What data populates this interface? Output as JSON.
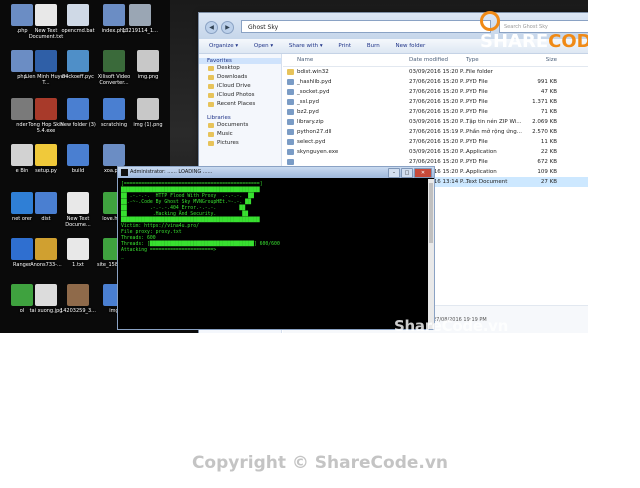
{
  "desktop_icons": [
    {
      "label": ".php",
      "color": "#6b8dc4"
    },
    {
      "label": "New Text Document.txt",
      "color": "#e8e8e8"
    },
    {
      "label": "opencmd.bat",
      "color": "#cfd9e6"
    },
    {
      "label": "index.php",
      "color": "#6b8dc4"
    },
    {
      "label": "13219114_1...",
      "color": "#9aa6b4"
    },
    {
      "label": "php",
      "color": "#6b8dc4"
    },
    {
      "label": "Lien Minh Huyen T...",
      "color": "#2f5fa7"
    },
    {
      "label": "84ckoeff.pyc",
      "color": "#4f8fc8"
    },
    {
      "label": "Xilisoft Video Converter...",
      "color": "#3a6a3a"
    },
    {
      "label": "img.png",
      "color": "#c8c8c8"
    },
    {
      "label": "nder",
      "color": "#7a7a7a"
    },
    {
      "label": "Tong Hop Skin 5.4.exe",
      "color": "#a83a2a"
    },
    {
      "label": "New folder (3)",
      "color": "#4a7fd1"
    },
    {
      "label": "scratching",
      "color": "#4a7fd1"
    },
    {
      "label": "img (1).png",
      "color": "#c8c8c8"
    },
    {
      "label": "e Bin",
      "color": "#d2d2d2"
    },
    {
      "label": "setup.py",
      "color": "#f0c93a"
    },
    {
      "label": "build",
      "color": "#4a7fd1"
    },
    {
      "label": "xoa.php",
      "color": "#6b8dc4"
    },
    {
      "label": "net orer",
      "color": "#2f7fd6"
    },
    {
      "label": "dist",
      "color": "#4a7fd1"
    },
    {
      "label": "New Text Docume...",
      "color": "#e8e8e8"
    },
    {
      "label": "love.html",
      "color": "#3fa23f"
    },
    {
      "label": "Ranger",
      "color": "#2f6fd0"
    },
    {
      "label": "Anons733-...",
      "color": "#d0a030"
    },
    {
      "label": "1.txt",
      "color": "#e8e8e8"
    },
    {
      "label": "site_158.html",
      "color": "#3fa23f"
    },
    {
      "label": "ol",
      "color": "#3fa23f"
    },
    {
      "label": "tai xuong.jpg",
      "color": "#dcdcdc"
    },
    {
      "label": "14203259_3...",
      "color": "#8f6a4a"
    },
    {
      "label": "img",
      "color": "#4a7fd1"
    }
  ],
  "explorer": {
    "address": "Ghost Sky",
    "search_placeholder": "Search Ghost Sky",
    "toolbar": {
      "organize": "Organize ▾",
      "open": "Open ▾",
      "share": "Share with ▾",
      "print": "Print",
      "burn": "Burn",
      "new_folder": "New folder"
    },
    "nav": {
      "favorites": "Favorites",
      "fav_items": [
        "Desktop",
        "Downloads",
        "iCloud Drive",
        "iCloud Photos",
        "Recent Places"
      ],
      "libraries": "Libraries",
      "lib_items": [
        "Documents",
        "Music",
        "Pictures"
      ]
    },
    "columns": {
      "name": "Name",
      "date": "Date modified",
      "type": "Type",
      "size": "Size"
    },
    "files": [
      {
        "name": "bdist.win32",
        "date": "03/09/2016 15:20 P...",
        "type": "File folder",
        "size": "",
        "folder": true
      },
      {
        "name": "_hashlib.pyd",
        "date": "27/06/2016 15:20 P...",
        "type": "PYD File",
        "size": "991 KB",
        "folder": false
      },
      {
        "name": "_socket.pyd",
        "date": "27/06/2016 15:20 P...",
        "type": "PYD File",
        "size": "47 KB",
        "folder": false
      },
      {
        "name": "_ssl.pyd",
        "date": "27/06/2016 15:20 P...",
        "type": "PYD File",
        "size": "1.371 KB",
        "folder": false
      },
      {
        "name": "bz2.pyd",
        "date": "27/06/2016 15:20 P...",
        "type": "PYD File",
        "size": "71 KB",
        "folder": false
      },
      {
        "name": "library.zip",
        "date": "03/09/2016 15:20 P...",
        "type": "Tập tin nén ZIP Wi...",
        "size": "2.069 KB",
        "folder": false
      },
      {
        "name": "python27.dll",
        "date": "27/06/2016 15:19 P...",
        "type": "Phần mở rộng ứng...",
        "size": "2.570 KB",
        "folder": false
      },
      {
        "name": "select.pyd",
        "date": "27/06/2016 15:20 P...",
        "type": "PYD File",
        "size": "11 KB",
        "folder": false
      },
      {
        "name": "skynguyen.exe",
        "date": "03/09/2016 15:20 P...",
        "type": "Application",
        "size": "22 KB",
        "folder": false
      },
      {
        "name": "",
        "date": "27/06/2016 15:20 P...",
        "type": "PYD File",
        "size": "672 KB",
        "folder": false
      },
      {
        "name": "",
        "date": "27/06/2016 15:20 P...",
        "type": "Application",
        "size": "109 KB",
        "folder": false
      },
      {
        "name": "",
        "date": "27/08/2016 13:14 P...",
        "type": "Text Document",
        "size": "27 KB",
        "folder": false,
        "selected": true
      }
    ],
    "status_date": "27/08/2016 19:19 PM"
  },
  "console": {
    "title": "Administrator: ...... LOADING ......",
    "lines": [
      "[===============================================]",
      "████████████████████████████████████████████████",
      "██ .-.-.-.  HTTP Flood With Proxy  .-.-.-.  ██",
      "██.-~-.Code By Ghost Sky MVNGroupHEt.~-.-. ██",
      "██        .-.-.-.404_Error.-.-.-.        ██",
      "██         .Hacking And Security.         ██",
      "████████████████████████████████████████████████",
      "Victim: https://vina4u.pro/",
      "File proxy: proxy.txt",
      "Threads: 600",
      "Threads: [████████████████████████████████████] 600/600",
      "Attacking ======================>",
      "_"
    ]
  },
  "watermark": "ShareCode.vn",
  "logo": {
    "part1": "SHARE",
    "part2": "CODE",
    ".vn": ".vn"
  },
  "copyright": "Copyright © ShareCode.vn"
}
